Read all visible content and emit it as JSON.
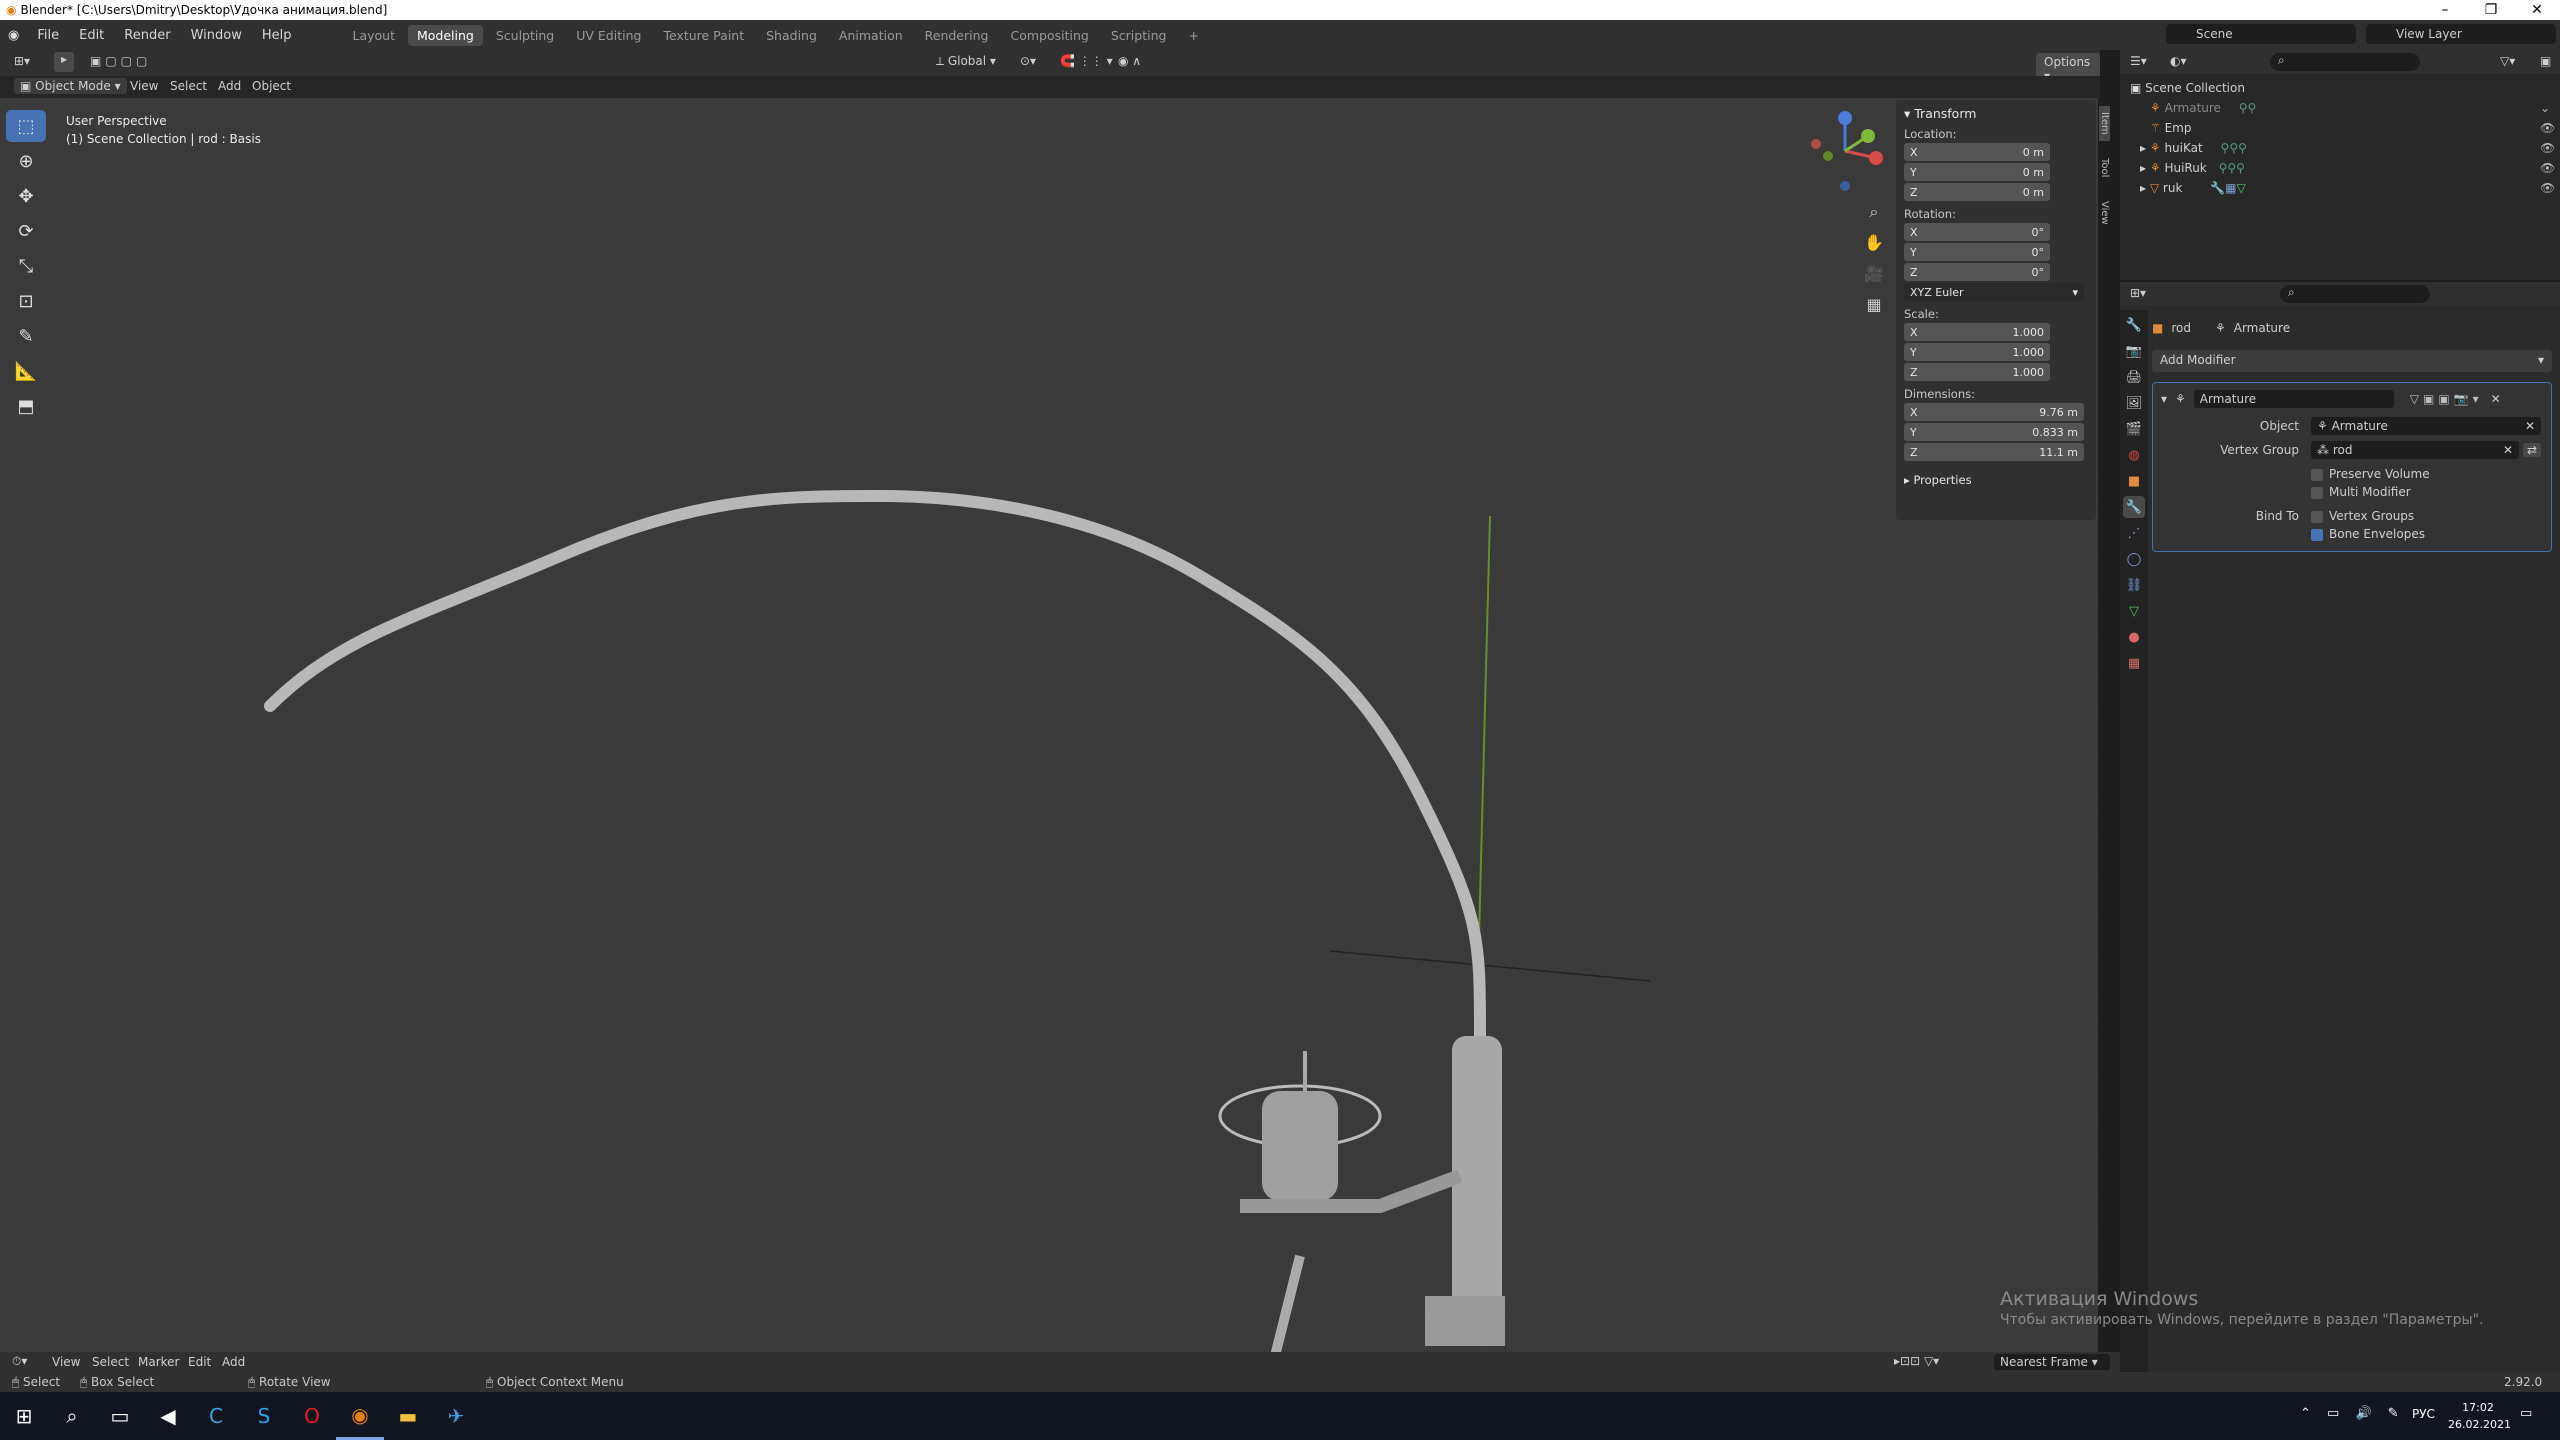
{
  "title": "Blender* [C:\\Users\\Dmitry\\Desktop\\Удочка анимация.blend]",
  "menu": [
    "File",
    "Edit",
    "Render",
    "Window",
    "Help"
  ],
  "workspaces": [
    "Layout",
    "Modeling",
    "Sculpting",
    "UV Editing",
    "Texture Paint",
    "Shading",
    "Animation",
    "Rendering",
    "Compositing",
    "Scripting"
  ],
  "active_workspace": "Modeling",
  "scene": "Scene",
  "view_layer": "View Layer",
  "toolbar": {
    "mode": "Object Mode",
    "view": "View",
    "select": "Select",
    "add": "Add",
    "object": "Object",
    "transform": "Global",
    "options": "Options"
  },
  "viewport": {
    "perspective": "User Perspective",
    "collection_info": "(1) Scene Collection | rod : Basis"
  },
  "npanel": {
    "transform_header": "Transform",
    "location_label": "Location:",
    "location": [
      {
        "axis": "X",
        "value": "0 m"
      },
      {
        "axis": "Y",
        "value": "0 m"
      },
      {
        "axis": "Z",
        "value": "0 m"
      }
    ],
    "rotation_label": "Rotation:",
    "rotation": [
      {
        "axis": "X",
        "value": "0°"
      },
      {
        "axis": "Y",
        "value": "0°"
      },
      {
        "axis": "Z",
        "value": "0°"
      }
    ],
    "rotation_mode": "XYZ Euler",
    "scale_label": "Scale:",
    "scale": [
      {
        "axis": "X",
        "value": "1.000"
      },
      {
        "axis": "Y",
        "value": "1.000"
      },
      {
        "axis": "Z",
        "value": "1.000"
      }
    ],
    "dimensions_label": "Dimensions:",
    "dimensions": [
      {
        "axis": "X",
        "value": "9.76 m"
      },
      {
        "axis": "Y",
        "value": "0.833 m"
      },
      {
        "axis": "Z",
        "value": "11.1 m"
      }
    ],
    "properties_header": "Properties",
    "tabs": [
      "Item",
      "Tool",
      "View"
    ]
  },
  "outliner": {
    "root": "Scene Collection",
    "items": [
      "Armature",
      "Emp",
      "huiKat",
      "HuiRuk",
      "ruk"
    ]
  },
  "properties": {
    "object_name": "rod",
    "modifier_context": "Armature",
    "add_modifier": "Add Modifier",
    "modifier_name": "Armature",
    "object_label": "Object",
    "object_value": "Armature",
    "vertex_group_label": "Vertex Group",
    "vertex_group_value": "rod",
    "preserve_volume": "Preserve Volume",
    "multi_modifier": "Multi Modifier",
    "bind_to_label": "Bind To",
    "vertex_groups": "Vertex Groups",
    "bone_envelopes": "Bone Envelopes"
  },
  "timeline": {
    "view": "View",
    "select": "Select",
    "marker": "Marker",
    "edit": "Edit",
    "add": "Add",
    "snap": "Nearest Frame"
  },
  "status": {
    "select": "Select",
    "box_select": "Box Select",
    "rotate": "Rotate View",
    "context": "Object Context Menu",
    "version": "2.92.0"
  },
  "activation": {
    "title": "Активация Windows",
    "subtitle": "Чтобы активировать Windows, перейдите в раздел \"Параметры\"."
  },
  "taskbar": {
    "lang": "РУС",
    "time": "17:02",
    "date": "26.02.2021"
  }
}
